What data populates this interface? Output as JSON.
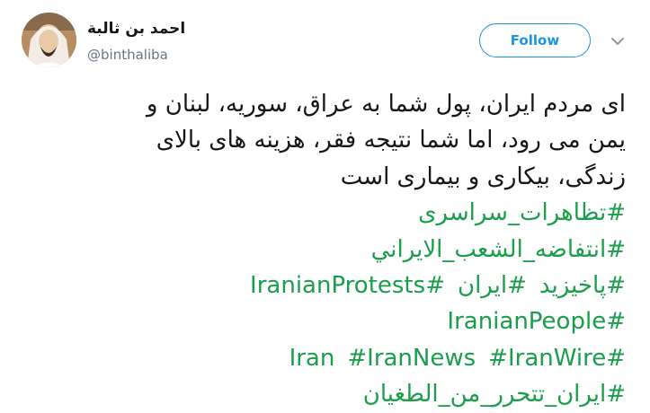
{
  "user": {
    "name": "احمد بن ثالبة",
    "handle": "@binthaliba"
  },
  "actions": {
    "follow_label": "Follow",
    "more_icon": "chevron-down-icon"
  },
  "tweet": {
    "text_lines": [
      "ای مردم ایران، پول شما به عراق، سوریه، لبنان و",
      "یمن می رود، اما شما نتیجه فقر، هزینه های بالای",
      "زندگی، بیکاری و بیماری است"
    ],
    "hashtags": {
      "line1": [
        "#تظاهرات_سراسری"
      ],
      "line2": [
        "#انتفاضه_الشعب_الايراني"
      ],
      "line3": [
        "#پاخیزید",
        "#ایران",
        "#IranianProtests"
      ],
      "line4": [
        "#IranianPeople"
      ],
      "line5": [
        "#Iran",
        "#IranNews",
        "#IranWire"
      ],
      "line6": [
        "#ایران_تتحرر_من_الطغيان"
      ]
    }
  },
  "colors": {
    "hashtag": "#1b9e4b",
    "follow_accent": "#1b95e0",
    "text": "#14171a",
    "muted": "#657786"
  }
}
